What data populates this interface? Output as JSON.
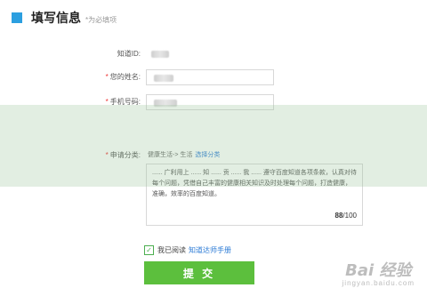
{
  "header": {
    "title": "填写信息",
    "note": "*为必填项"
  },
  "form": {
    "zhidao_id": {
      "label": "知道ID:"
    },
    "name": {
      "label": "您的姓名:",
      "required": "*"
    },
    "phone": {
      "label": "手机号码:",
      "required": "*"
    },
    "category": {
      "label": "申请分类:",
      "required": "*",
      "value": "健康生活-> 生活",
      "link": "选择分类"
    },
    "intro": {
      "text": "...... 广利用上 ...... 知 ...... 贡 ...... 我 ...... 遵守百度知道各项条款，认真对待每个问题，凭借自己丰富的健康相关知识及时处理每个问题，打造健康，准确，效率的百度知道。",
      "count": "88",
      "max": "/100"
    }
  },
  "agree": {
    "text": "我已阅读",
    "link": "知道达师手册"
  },
  "submit_label": "提 交",
  "watermark": {
    "logo": "Bai 经验",
    "sub": "jingyan.baidu.com"
  },
  "colors": {
    "accent": "#2c9fe0",
    "submit": "#5cbf3d",
    "link": "#2c7bd6"
  }
}
